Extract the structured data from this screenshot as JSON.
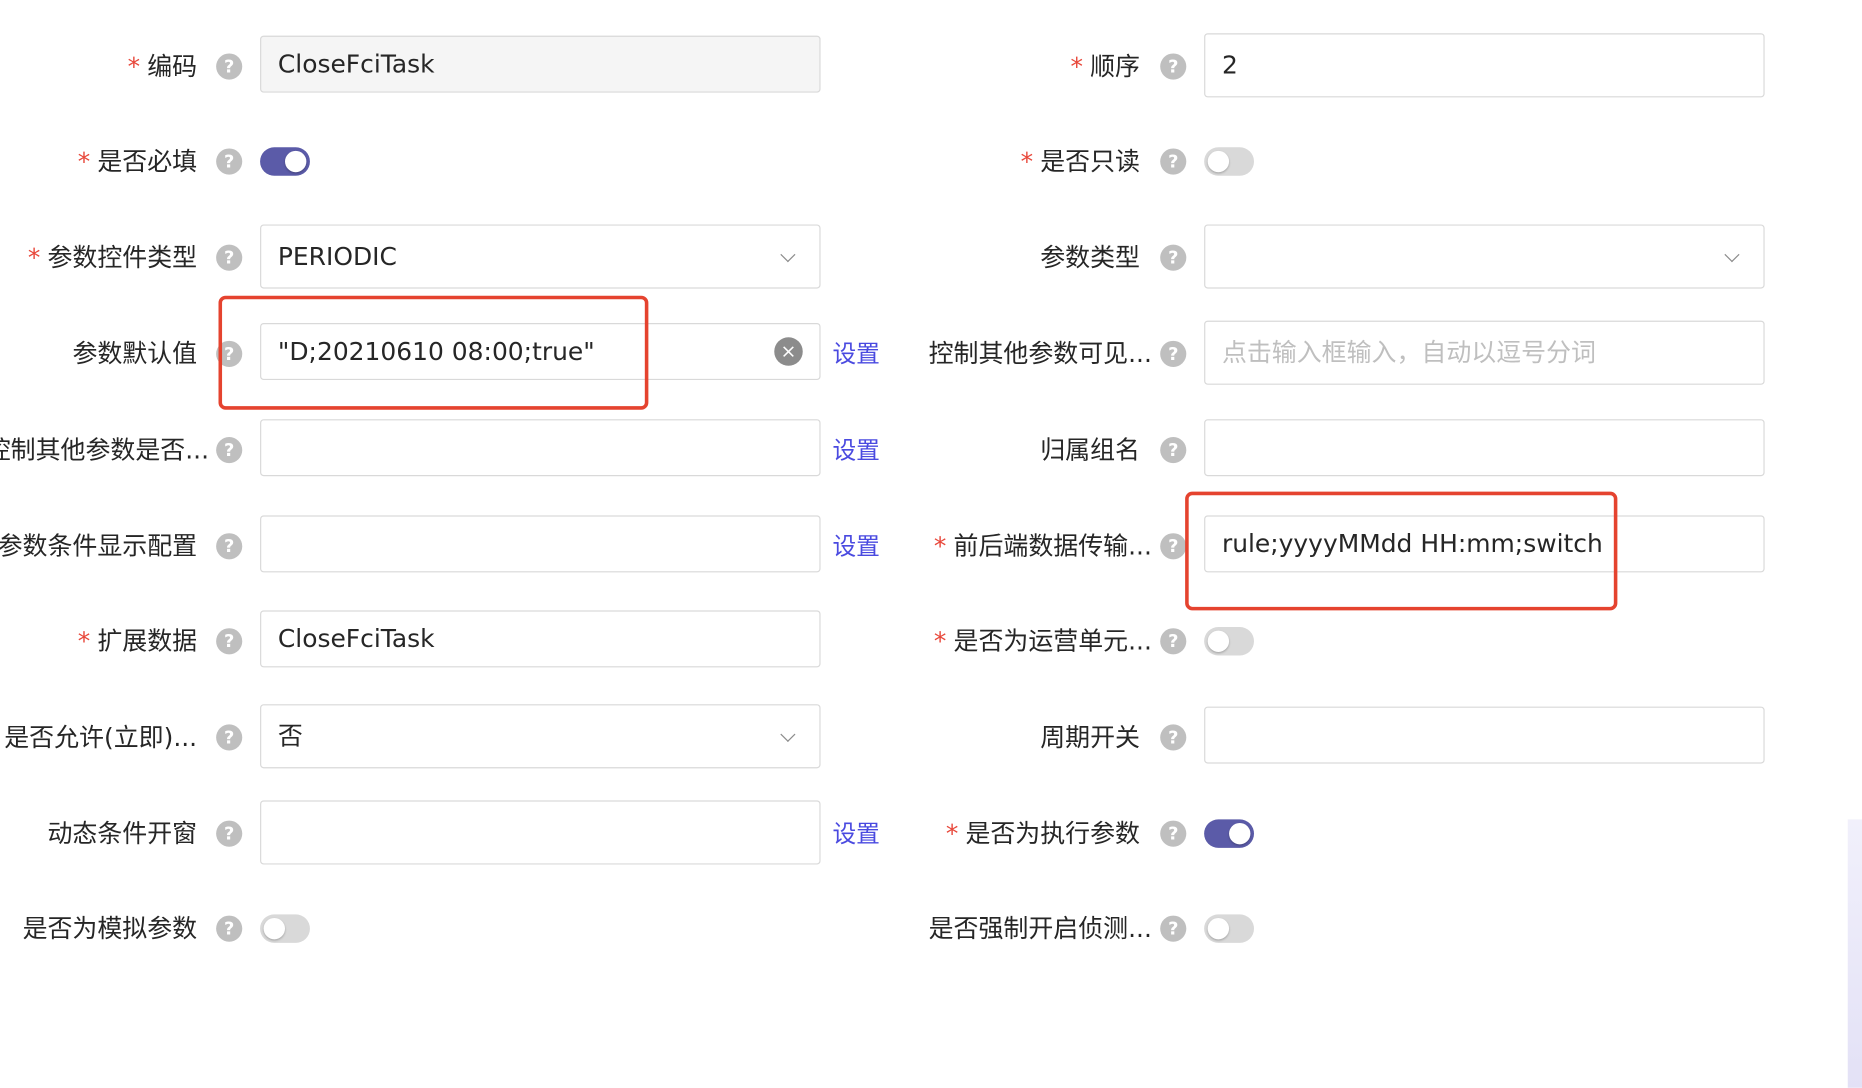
{
  "colors": {
    "accent": "#5b5ba8",
    "required": "#e8473a",
    "link": "#4a4ae0",
    "highlight": "#e5432f"
  },
  "help_glyph": "?",
  "clear_glyph": "×",
  "fields": {
    "code": {
      "label": "编码",
      "value": "CloseFciTask"
    },
    "order": {
      "label": "顺序",
      "value": "2"
    },
    "required": {
      "label": "是否必填",
      "on": true
    },
    "readonly": {
      "label": "是否只读",
      "on": false
    },
    "control_type": {
      "label": "参数控件类型",
      "value": "PERIODIC"
    },
    "param_type": {
      "label": "参数类型",
      "value": ""
    },
    "default_value": {
      "label": "参数默认值",
      "value": "\"D;20210610 08:00;true\"",
      "link": "设置"
    },
    "control_visible": {
      "label": "控制其他参数可见...",
      "placeholder": "点击输入框输入，自动以逗号分词"
    },
    "control_other": {
      "label": "控制其他参数是否...",
      "value": "",
      "link": "设置"
    },
    "group_name": {
      "label": "归属组名",
      "value": ""
    },
    "condition_display": {
      "label": "参数条件显示配置",
      "value": "",
      "link": "设置"
    },
    "transfer_format": {
      "label": "前后端数据传输...",
      "value": "rule;yyyyMMdd HH:mm;switch"
    },
    "ext_data": {
      "label": "扩展数据",
      "value": "CloseFciTask"
    },
    "ops_unit": {
      "label": "是否为运营单元...",
      "on": false
    },
    "allow_immediate": {
      "label": "是否允许(立即)...",
      "value": "否"
    },
    "period_switch": {
      "label": "周期开关",
      "value": ""
    },
    "dynamic_window": {
      "label": "动态条件开窗",
      "value": "",
      "link": "设置"
    },
    "exec_param": {
      "label": "是否为执行参数",
      "on": true
    },
    "mock_param": {
      "label": "是否为模拟参数",
      "on": false
    },
    "force_detect": {
      "label": "是否强制开启侦测...",
      "on": false
    }
  }
}
